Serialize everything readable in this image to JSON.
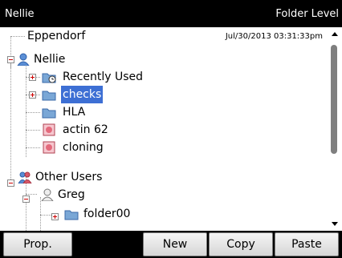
{
  "title": {
    "left": "Nellie",
    "right": "Folder Level"
  },
  "timestamp": "Jul/30/2013 03:31:33pm",
  "tree": {
    "root": "Eppendorf",
    "nellie": "Nellie",
    "recently_used": "Recently Used",
    "checks": "checks",
    "hla": "HLA",
    "actin": "actin 62",
    "cloning": "cloning",
    "other_users": "Other Users",
    "greg": "Greg",
    "folder00": "folder00"
  },
  "buttons": {
    "prop": "Prop.",
    "new": "New",
    "copy": "Copy",
    "paste": "Paste"
  },
  "colors": {
    "selection": "#3d6fd4",
    "folder": "#7aa7d6",
    "document": "#e46a7c",
    "bars": "#000000"
  },
  "icons": {
    "user": "user-icon",
    "users": "users-group-icon",
    "folder": "folder-icon",
    "recent": "recent-folder-icon",
    "doc": "document-icon"
  }
}
